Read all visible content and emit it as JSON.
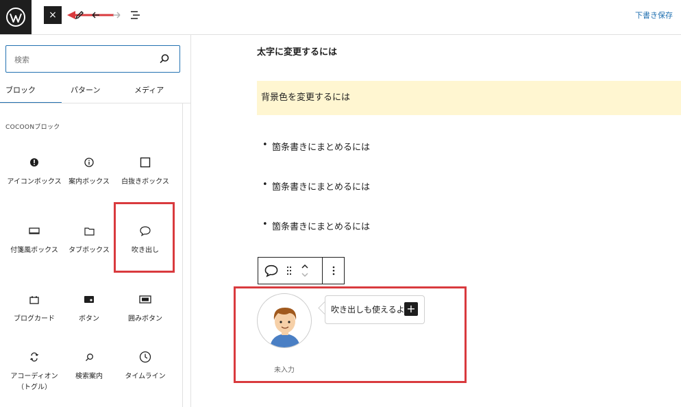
{
  "header": {
    "close_label": "×",
    "save_draft": "下書き保存"
  },
  "sidebar": {
    "search": {
      "placeholder": "検索"
    },
    "tabs": [
      "ブロック",
      "パターン",
      "メディア"
    ],
    "active_tab": 0,
    "category_title": "COCOONブロック",
    "blocks": [
      {
        "label": "アイコンボックス",
        "icon": "alert-circle-icon"
      },
      {
        "label": "案内ボックス",
        "icon": "info-icon"
      },
      {
        "label": "白抜きボックス",
        "icon": "square-icon"
      },
      {
        "label": "付箋風ボックス",
        "icon": "sticky-note-icon"
      },
      {
        "label": "タブボックス",
        "icon": "folder-icon"
      },
      {
        "label": "吹き出し",
        "icon": "speech-bubble-icon"
      },
      {
        "label": "ブログカード",
        "icon": "calendar-card-icon"
      },
      {
        "label": "ボタン",
        "icon": "button-icon"
      },
      {
        "label": "囲みボタン",
        "icon": "framed-button-icon"
      },
      {
        "label": "アコーディオン（トグル）",
        "icon": "toggle-arrows-icon"
      },
      {
        "label": "検索案内",
        "icon": "search-icon"
      },
      {
        "label": "タイムライン",
        "icon": "clock-icon"
      }
    ]
  },
  "editor": {
    "bold_paragraph": "太字に変更するには",
    "bg_paragraph": "背景色を変更するには",
    "list_items": [
      "箇条書きにまとめるには",
      "箇条書きにまとめるには",
      "箇条書きにまとめるには"
    ],
    "balloon": {
      "text": "吹き出しも使えるよ",
      "caption": "未入力"
    }
  },
  "colors": {
    "accent": "#2271b1",
    "highlight_red": "#d93a3e",
    "bg_yellow": "#fff6d1",
    "dark": "#1e1e1e"
  }
}
